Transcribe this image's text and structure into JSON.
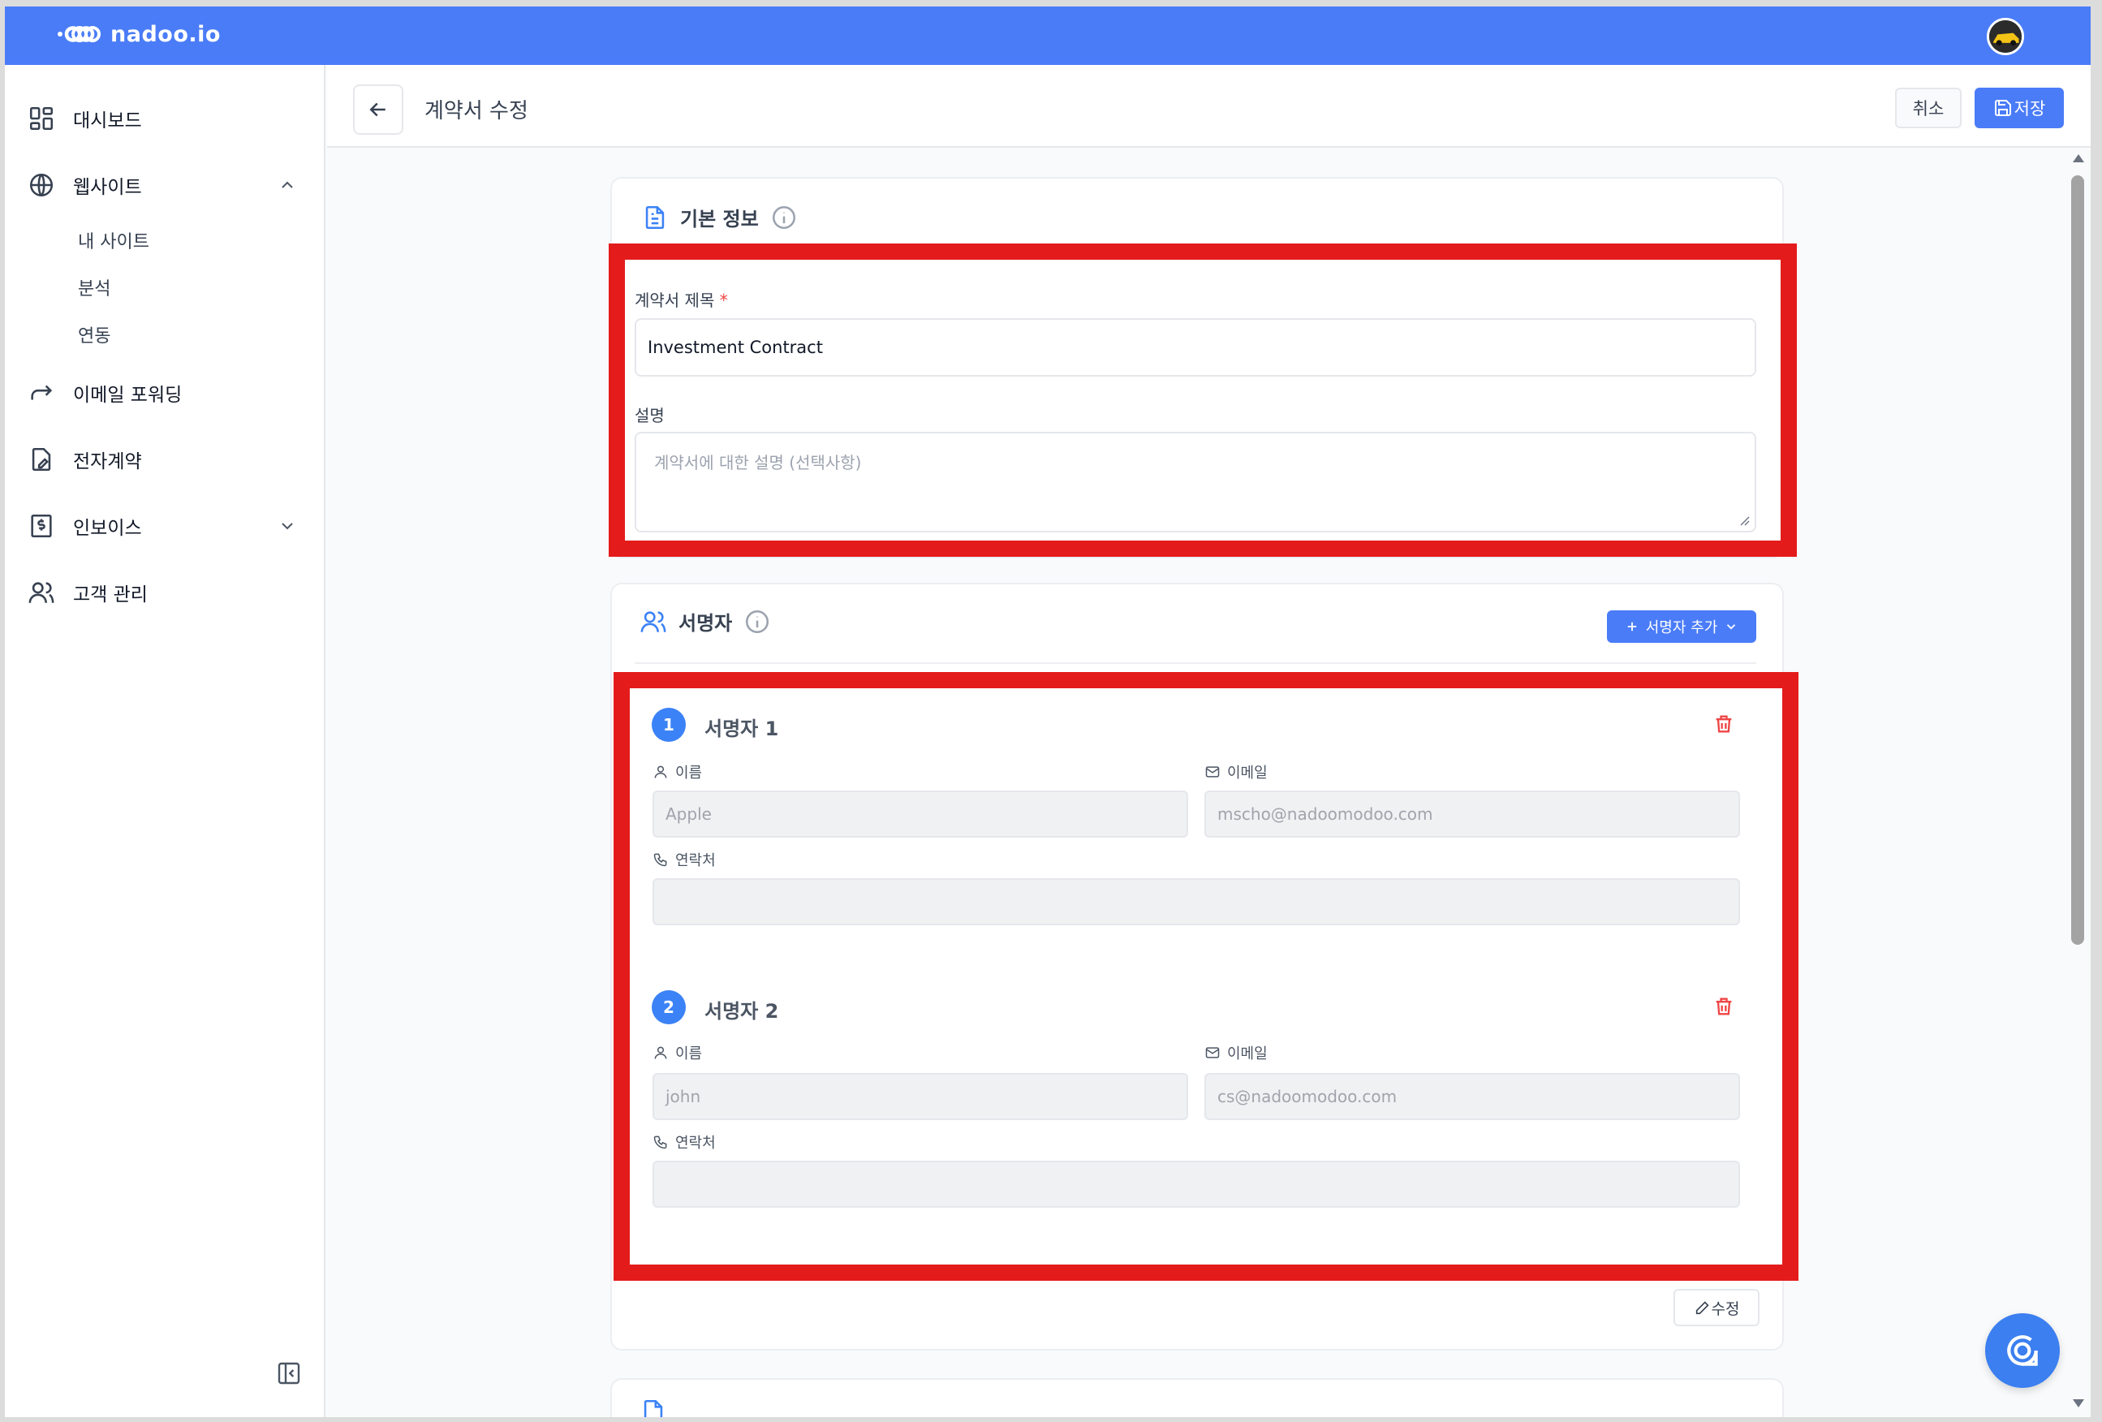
{
  "app": {
    "name": "nadoo.io"
  },
  "colors": {
    "brand": "#4a7cf7",
    "highlight": "#e41b1b",
    "danger": "#ef4444"
  },
  "sidebar": {
    "items": [
      {
        "label": "대시보드",
        "icon": "dashboard-icon"
      },
      {
        "label": "웹사이트",
        "icon": "globe-icon",
        "expanded": true,
        "children": [
          "내 사이트",
          "분석",
          "연동"
        ]
      },
      {
        "label": "이메일 포워딩",
        "icon": "forward-icon"
      },
      {
        "label": "전자계약",
        "icon": "contract-icon"
      },
      {
        "label": "인보이스",
        "icon": "invoice-icon",
        "expanded": false
      },
      {
        "label": "고객 관리",
        "icon": "users-icon"
      }
    ]
  },
  "header": {
    "title": "계약서 수정",
    "cancel_label": "취소",
    "save_label": "저장"
  },
  "basic_info": {
    "title": "기본 정보",
    "contract_title_label": "계약서 제목",
    "required_mark": "*",
    "contract_title_value": "Investment Contract",
    "description_label": "설명",
    "description_placeholder": "계약서에 대한 설명 (선택사항)"
  },
  "signers": {
    "title": "서명자",
    "add_label": "서명자 추가",
    "name_label": "이름",
    "email_label": "이메일",
    "phone_label": "연락처",
    "list": [
      {
        "number": "1",
        "title": "서명자 1",
        "name": "Apple",
        "email": "mscho@nadoomodoo.com",
        "phone": ""
      },
      {
        "number": "2",
        "title": "서명자 2",
        "name": "john",
        "email": "cs@nadoomodoo.com",
        "phone": ""
      }
    ],
    "edit_label": "수정"
  }
}
